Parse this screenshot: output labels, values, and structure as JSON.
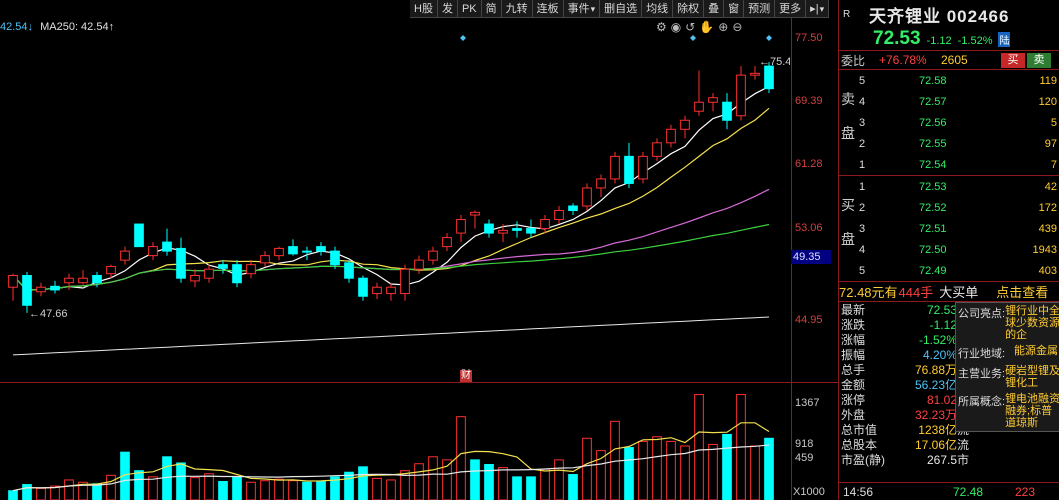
{
  "toolbar": [
    {
      "label": "H股",
      "name": "tb-hgu"
    },
    {
      "label": "发",
      "name": "tb-fa"
    },
    {
      "label": "PK",
      "name": "tb-pk"
    },
    {
      "label": "简",
      "name": "tb-jian"
    },
    {
      "label": "九转",
      "name": "tb-jiuzhuan"
    },
    {
      "label": "连板",
      "name": "tb-lianban"
    },
    {
      "label": "事件",
      "name": "tb-shijian",
      "dropdown": true
    },
    {
      "label": "删自选",
      "name": "tb-delete-watch"
    },
    {
      "label": "均线",
      "name": "tb-junxian"
    },
    {
      "label": "除权",
      "name": "tb-chuquan"
    },
    {
      "label": "叠",
      "name": "tb-die"
    },
    {
      "label": "窗",
      "name": "tb-chuang"
    },
    {
      "label": "预测",
      "name": "tb-yuce"
    },
    {
      "label": "更多",
      "name": "tb-more"
    },
    {
      "label": "▸|",
      "name": "tb-expand",
      "dropdown": true
    }
  ],
  "ma_legend": {
    "ma1": "42.54↓",
    "ma250": "MA250: 42.54↑"
  },
  "icons": [
    "settings-icon",
    "eye-icon",
    "rewind-icon",
    "hand-icon",
    "zoom-in-icon",
    "zoom-out-icon"
  ],
  "price_axis": [
    "77.50",
    "69.39",
    "61.28",
    "53.06",
    "44.95"
  ],
  "price_cursor": "49.35",
  "volume_axis": [
    "1367",
    "918",
    "459"
  ],
  "volume_multiplier": "X1000",
  "annotations": {
    "high": "75.46",
    "low": "47.66",
    "cai": "财"
  },
  "chart_data": {
    "type": "candlestick",
    "ylim": [
      40,
      79
    ],
    "candles": [
      [
        50.5,
        52.0,
        49.0,
        51.8,
        "up"
      ],
      [
        51.8,
        52.2,
        47.66,
        48.5,
        "down"
      ],
      [
        50.0,
        51.0,
        49.5,
        50.5,
        "up"
      ],
      [
        50.2,
        51.2,
        49.8,
        50.6,
        "down"
      ],
      [
        51.0,
        52.0,
        50.2,
        51.5,
        "up"
      ],
      [
        51.5,
        52.4,
        50.8,
        51.0,
        "up"
      ],
      [
        51.0,
        52.2,
        50.5,
        51.8,
        "down"
      ],
      [
        52.0,
        53.0,
        51.5,
        52.8,
        "up"
      ],
      [
        53.5,
        55.0,
        53.0,
        54.5,
        "up"
      ],
      [
        55.0,
        55.6,
        56.5,
        57.5,
        "down"
      ],
      [
        54.0,
        55.5,
        53.5,
        55.0,
        "up"
      ],
      [
        55.5,
        57.0,
        54.0,
        54.5,
        "down"
      ],
      [
        54.8,
        56.0,
        51.0,
        51.5,
        "down"
      ],
      [
        51.8,
        52.5,
        50.5,
        51.2,
        "up"
      ],
      [
        51.5,
        53.0,
        51.0,
        52.5,
        "up"
      ],
      [
        52.6,
        53.5,
        52.0,
        53.0,
        "down"
      ],
      [
        53.0,
        53.5,
        50.5,
        51.0,
        "down"
      ],
      [
        52.0,
        53.5,
        51.5,
        53.0,
        "up"
      ],
      [
        53.2,
        54.5,
        52.8,
        54.0,
        "up"
      ],
      [
        54.0,
        55.0,
        53.5,
        54.8,
        "up"
      ],
      [
        55.0,
        55.8,
        54.0,
        54.2,
        "down"
      ],
      [
        54.5,
        55.0,
        53.5,
        54.5,
        "down"
      ],
      [
        54.5,
        55.5,
        54.0,
        55.0,
        "down"
      ],
      [
        54.5,
        55.0,
        52.5,
        53.0,
        "down"
      ],
      [
        53.2,
        53.5,
        51.0,
        51.5,
        "down"
      ],
      [
        51.5,
        51.8,
        49.0,
        49.5,
        "down"
      ],
      [
        49.8,
        51.0,
        49.2,
        50.5,
        "up"
      ],
      [
        50.5,
        51.0,
        49.0,
        49.8,
        "up"
      ],
      [
        49.8,
        53.0,
        49.0,
        52.5,
        "up"
      ],
      [
        52.5,
        54.0,
        52.0,
        53.5,
        "up"
      ],
      [
        53.5,
        55.0,
        53.0,
        54.5,
        "up"
      ],
      [
        55.0,
        56.5,
        54.5,
        56.0,
        "up"
      ],
      [
        56.5,
        58.5,
        55.5,
        58.0,
        "up"
      ],
      [
        58.5,
        59.0,
        57.0,
        58.8,
        "up"
      ],
      [
        57.5,
        58.0,
        56.0,
        56.5,
        "down"
      ],
      [
        56.5,
        57.5,
        55.5,
        56.8,
        "up"
      ],
      [
        56.8,
        57.8,
        56.0,
        57.0,
        "down"
      ],
      [
        57.0,
        58.0,
        56.0,
        56.5,
        "down"
      ],
      [
        57.0,
        58.5,
        56.5,
        58.0,
        "up"
      ],
      [
        58.0,
        59.5,
        57.5,
        59.0,
        "up"
      ],
      [
        59.0,
        59.8,
        58.5,
        59.5,
        "down"
      ],
      [
        59.5,
        62.0,
        59.0,
        61.5,
        "up"
      ],
      [
        61.5,
        63.0,
        60.5,
        62.5,
        "up"
      ],
      [
        62.5,
        65.5,
        62.0,
        65.0,
        "up"
      ],
      [
        65.0,
        66.5,
        61.5,
        62.0,
        "down"
      ],
      [
        62.5,
        65.5,
        62.0,
        65.0,
        "up"
      ],
      [
        65.0,
        67.0,
        64.5,
        66.5,
        "up"
      ],
      [
        66.5,
        68.5,
        66.0,
        68.0,
        "up"
      ],
      [
        68.0,
        69.5,
        67.0,
        69.0,
        "up"
      ],
      [
        70.0,
        74.5,
        69.5,
        71.0,
        "up"
      ],
      [
        71.0,
        72.0,
        70.0,
        71.5,
        "up"
      ],
      [
        71.0,
        72.0,
        68.0,
        69.0,
        "down"
      ],
      [
        69.5,
        75.0,
        69.0,
        74.0,
        "up"
      ],
      [
        74.0,
        75.0,
        73.5,
        74.2,
        "up"
      ],
      [
        72.5,
        75.46,
        72.0,
        75.0,
        "down"
      ]
    ],
    "volumes": [
      [
        120,
        "down"
      ],
      [
        200,
        "down"
      ],
      [
        150,
        "up"
      ],
      [
        180,
        "up"
      ],
      [
        260,
        "up"
      ],
      [
        230,
        "up"
      ],
      [
        210,
        "down"
      ],
      [
        320,
        "up"
      ],
      [
        620,
        "down"
      ],
      [
        380,
        "down"
      ],
      [
        300,
        "up"
      ],
      [
        560,
        "down"
      ],
      [
        480,
        "down"
      ],
      [
        290,
        "up"
      ],
      [
        340,
        "up"
      ],
      [
        240,
        "down"
      ],
      [
        300,
        "down"
      ],
      [
        230,
        "up"
      ],
      [
        250,
        "up"
      ],
      [
        270,
        "up"
      ],
      [
        250,
        "up"
      ],
      [
        230,
        "down"
      ],
      [
        240,
        "down"
      ],
      [
        300,
        "down"
      ],
      [
        360,
        "down"
      ],
      [
        430,
        "down"
      ],
      [
        280,
        "up"
      ],
      [
        260,
        "up"
      ],
      [
        380,
        "up"
      ],
      [
        470,
        "up"
      ],
      [
        560,
        "up"
      ],
      [
        520,
        "up"
      ],
      [
        1080,
        "up"
      ],
      [
        520,
        "down"
      ],
      [
        460,
        "down"
      ],
      [
        420,
        "up"
      ],
      [
        300,
        "down"
      ],
      [
        300,
        "down"
      ],
      [
        400,
        "up"
      ],
      [
        520,
        "up"
      ],
      [
        330,
        "down"
      ],
      [
        800,
        "up"
      ],
      [
        640,
        "up"
      ],
      [
        1020,
        "up"
      ],
      [
        680,
        "down"
      ],
      [
        760,
        "up"
      ],
      [
        820,
        "up"
      ],
      [
        760,
        "up"
      ],
      [
        700,
        "up"
      ],
      [
        1367,
        "up"
      ],
      [
        720,
        "up"
      ],
      [
        850,
        "down"
      ],
      [
        1367,
        "up"
      ],
      [
        700,
        "up"
      ],
      [
        800,
        "down"
      ]
    ]
  },
  "panel": {
    "r_mark": "R",
    "name": "天齐锂业 002466",
    "last": "72.53",
    "change": "-1.12",
    "change_pct": "-1.52%",
    "flag": "陆",
    "weibi_label": "委比",
    "weibi_value": "+76.78%",
    "weicha": "2605",
    "buy_btn": "买",
    "sell_btn": "卖",
    "sell_label_1": "卖",
    "sell_label_2": "盘",
    "buy_label_1": "买",
    "buy_label_2": "盘",
    "asks": [
      {
        "lv": "5",
        "price": "72.58",
        "vol": "119"
      },
      {
        "lv": "4",
        "price": "72.57",
        "vol": "120"
      },
      {
        "lv": "3",
        "price": "72.56",
        "vol": "5"
      },
      {
        "lv": "2",
        "price": "72.55",
        "vol": "97"
      },
      {
        "lv": "1",
        "price": "72.54",
        "vol": "7"
      }
    ],
    "bids": [
      {
        "lv": "1",
        "price": "72.53",
        "vol": "42"
      },
      {
        "lv": "2",
        "price": "72.52",
        "vol": "172"
      },
      {
        "lv": "3",
        "price": "72.51",
        "vol": "439"
      },
      {
        "lv": "4",
        "price": "72.50",
        "vol": "1943"
      },
      {
        "lv": "5",
        "price": "72.49",
        "vol": "403"
      }
    ],
    "trade_price": "72.48元有",
    "trade_vol": "444手",
    "trade_type": "大买单",
    "trade_link": "点击查看",
    "stats": [
      {
        "l": "最新",
        "v": "72.53",
        "c": "green",
        "u": "开"
      },
      {
        "l": "涨跌",
        "v": "-1.12",
        "c": "green",
        "u": "最"
      },
      {
        "l": "涨幅",
        "v": "-1.52%",
        "c": "green",
        "u": "最"
      },
      {
        "l": "振幅",
        "v": "4.20%",
        "c": "cyan",
        "u": "量"
      },
      {
        "l": "总手",
        "v": "76.88万",
        "c": "yellow",
        "u": "换"
      },
      {
        "l": "金额",
        "v": "56.23亿",
        "c": "cyan",
        "u": "换"
      },
      {
        "l": "涨停",
        "v": "81.02",
        "c": "red",
        "u": "跌"
      },
      {
        "l": "外盘",
        "v": "32.23万",
        "c": "red",
        "u": "内"
      },
      {
        "l": "总市值",
        "v": "1238亿",
        "c": "yellow",
        "u": "流"
      },
      {
        "l": "总股本",
        "v": "17.06亿",
        "c": "yellow",
        "u": "流"
      },
      {
        "l": "市盈(静)",
        "v": "267.5",
        "c": "white",
        "u": "市"
      }
    ],
    "ah_tag": "AH",
    "f10": [
      {
        "k": "公司亮点:",
        "v": "锂行业中全球少数资源的企"
      },
      {
        "k": "行业地域:",
        "v": "能源金属"
      },
      {
        "k": "主营业务:",
        "v": "硬岩型锂及锂化工"
      },
      {
        "k": "所属概念:",
        "v": "锂电池融资融券;标普道琼斯"
      }
    ],
    "bottom": {
      "time": "14:56",
      "price": "72.48",
      "vol": "223"
    }
  }
}
